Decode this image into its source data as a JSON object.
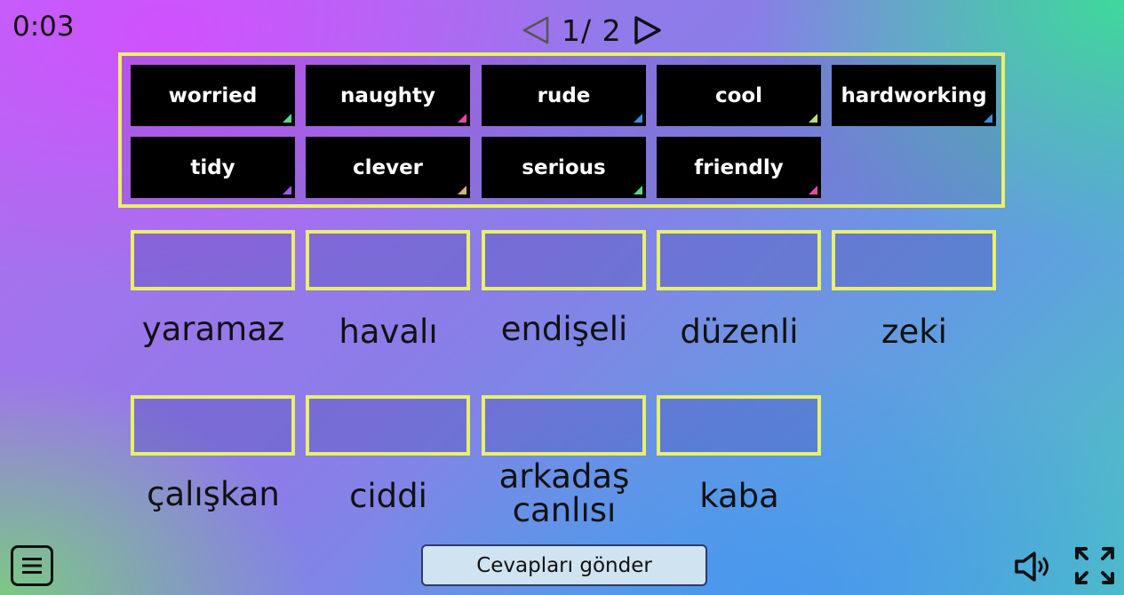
{
  "timer": "0:03",
  "pager": {
    "label": "1/ 2",
    "prev_icon": "triangle-left-outline-icon",
    "next_icon": "triangle-right-outline-icon"
  },
  "cards": [
    {
      "text": "worried",
      "corner": "#58d68d"
    },
    {
      "text": "naughty",
      "corner": "#e64aa8"
    },
    {
      "text": "rude",
      "corner": "#3b8fe0"
    },
    {
      "text": "cool",
      "corner": "#b8e07a"
    },
    {
      "text": "hardworking",
      "corner": "#3b8fe0"
    },
    {
      "text": "tidy",
      "corner": "#a45ae8"
    },
    {
      "text": "clever",
      "corner": "#d6b08a"
    },
    {
      "text": "serious",
      "corner": "#58d68d"
    },
    {
      "text": "friendly",
      "corner": "#e64aa8"
    }
  ],
  "targets": [
    {
      "label": "yaramaz"
    },
    {
      "label": "havalı"
    },
    {
      "label": "endişeli"
    },
    {
      "label": "düzenli"
    },
    {
      "label": "zeki"
    },
    {
      "label": "çalışkan"
    },
    {
      "label": "ciddi"
    },
    {
      "label": "arkadaş canlısı"
    },
    {
      "label": "kaba"
    }
  ],
  "footer": {
    "submit_label": "Cevapları gönder",
    "menu_icon": "menu-icon",
    "sound_icon": "speaker-icon",
    "fullscreen_icon": "fullscreen-icon"
  },
  "colors": {
    "slot_border": "#e9f06a",
    "card_bg": "#000000",
    "card_text": "#ffffff"
  }
}
